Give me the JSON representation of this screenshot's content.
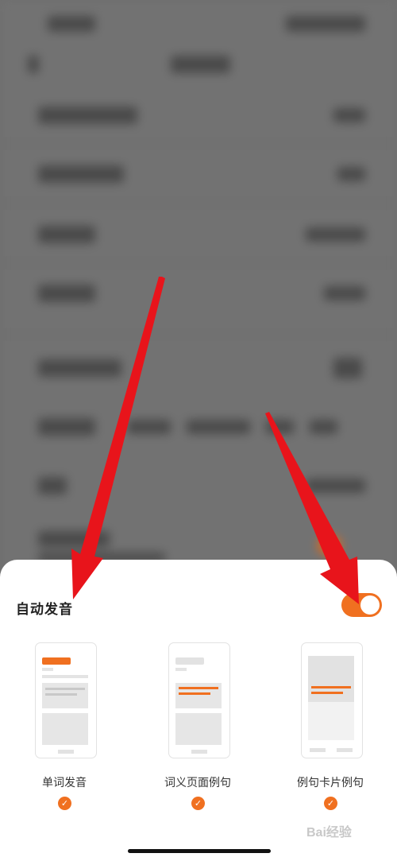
{
  "sheet": {
    "title": "自动发音",
    "auto_play_enabled": true,
    "options": [
      {
        "label": "单词发音",
        "checked": true
      },
      {
        "label": "词义页面例句",
        "checked": true
      },
      {
        "label": "例句卡片例句",
        "checked": true
      }
    ],
    "check_glyph": "✓"
  },
  "colors": {
    "accent": "#f07020",
    "arrow": "#e8141b"
  },
  "watermark": "Bai经验"
}
